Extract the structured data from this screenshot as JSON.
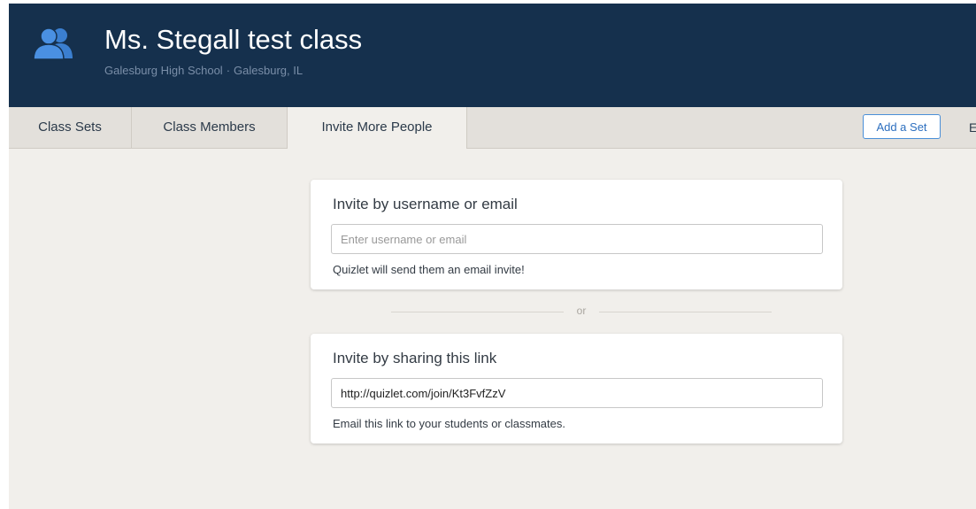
{
  "header": {
    "title": "Ms. Stegall test class",
    "school": "Galesburg High School",
    "separator": "·",
    "location": "Galesburg, IL",
    "icon": "class-group-icon",
    "background_color": "#15304d",
    "icon_color": "#4a90e2"
  },
  "tabs": [
    {
      "label": "Class Sets",
      "active": false
    },
    {
      "label": "Class Members",
      "active": false
    },
    {
      "label": "Invite More People",
      "active": true
    }
  ],
  "toolbar": {
    "add_set_label": "Add a Set",
    "edit_label_clipped": "E"
  },
  "invite_username": {
    "title": "Invite by username or email",
    "placeholder": "Enter username or email",
    "value": "",
    "hint": "Quizlet will send them an email invite!"
  },
  "divider": {
    "label": "or"
  },
  "invite_link": {
    "title": "Invite by sharing this link",
    "value": "http://quizlet.com/join/Kt3FvfZzV",
    "hint": "Email this link to your students or classmates."
  },
  "colors": {
    "accent": "#4a8fd8",
    "page_background": "#f1efeb",
    "tab_bar": "#e3e0db"
  }
}
